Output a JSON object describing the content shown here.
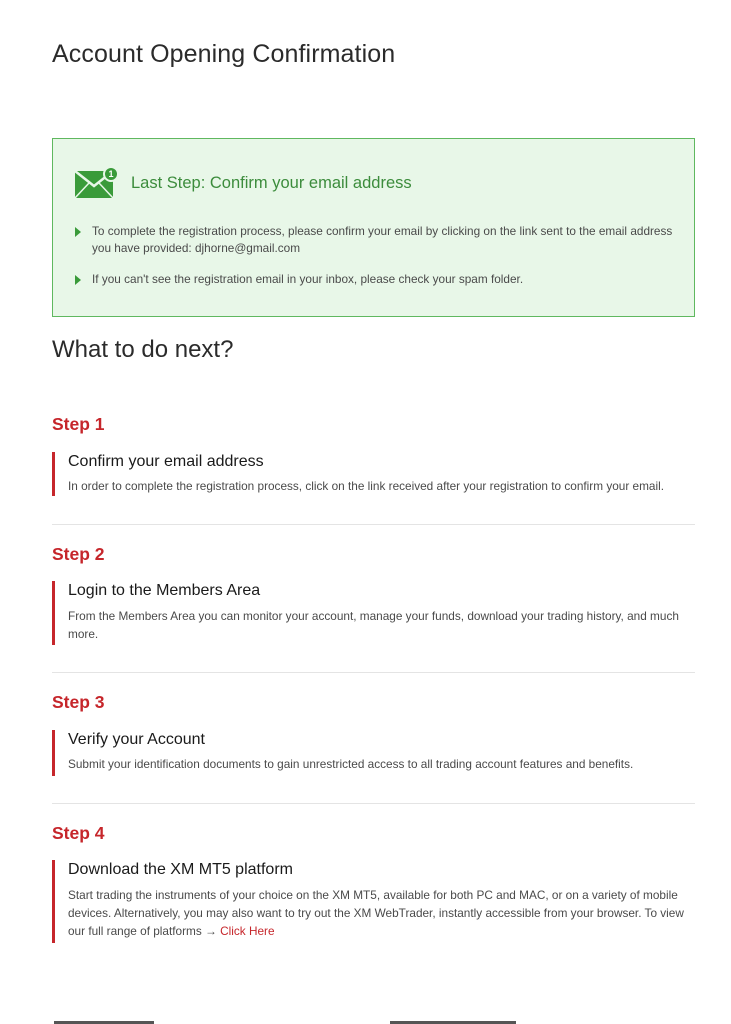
{
  "page": {
    "title": "Account Opening Confirmation"
  },
  "notice": {
    "badge": "1",
    "title": "Last Step: Confirm your email address",
    "items": [
      "To complete the registration process, please confirm your email by clicking on the link sent to the email address you have provided: djhorne@gmail.com",
      "If you can't see the registration email in your inbox, please check your spam folder."
    ],
    "icon": "envelope-icon",
    "accent_color": "#3a9b3a"
  },
  "next": {
    "title": "What to do next?"
  },
  "steps": [
    {
      "label": "Step 1",
      "heading": "Confirm your email address",
      "text": "In order to complete the registration process, click on the link received after your registration to confirm your email."
    },
    {
      "label": "Step 2",
      "heading": "Login to the Members Area",
      "text": "From the Members Area you can monitor your account, manage your funds, download your trading history, and much more."
    },
    {
      "label": "Step 3",
      "heading": "Verify your Account",
      "text": "Submit your identification documents to gain unrestricted access to all trading account features and benefits."
    },
    {
      "label": "Step 4",
      "heading": "Download the XM MT5 platform",
      "text": "Start trading the instruments of your choice on the XM MT5, available for both PC and MAC, or on a variety of mobile devices. Alternatively, you may also want to try out the XM WebTrader, instantly accessible from your browser. To view our full range of platforms →",
      "link": "Click Here"
    }
  ],
  "colors": {
    "step_red": "#c6262b",
    "notice_bg": "#e8f7e8",
    "notice_border": "#5fb85f"
  }
}
